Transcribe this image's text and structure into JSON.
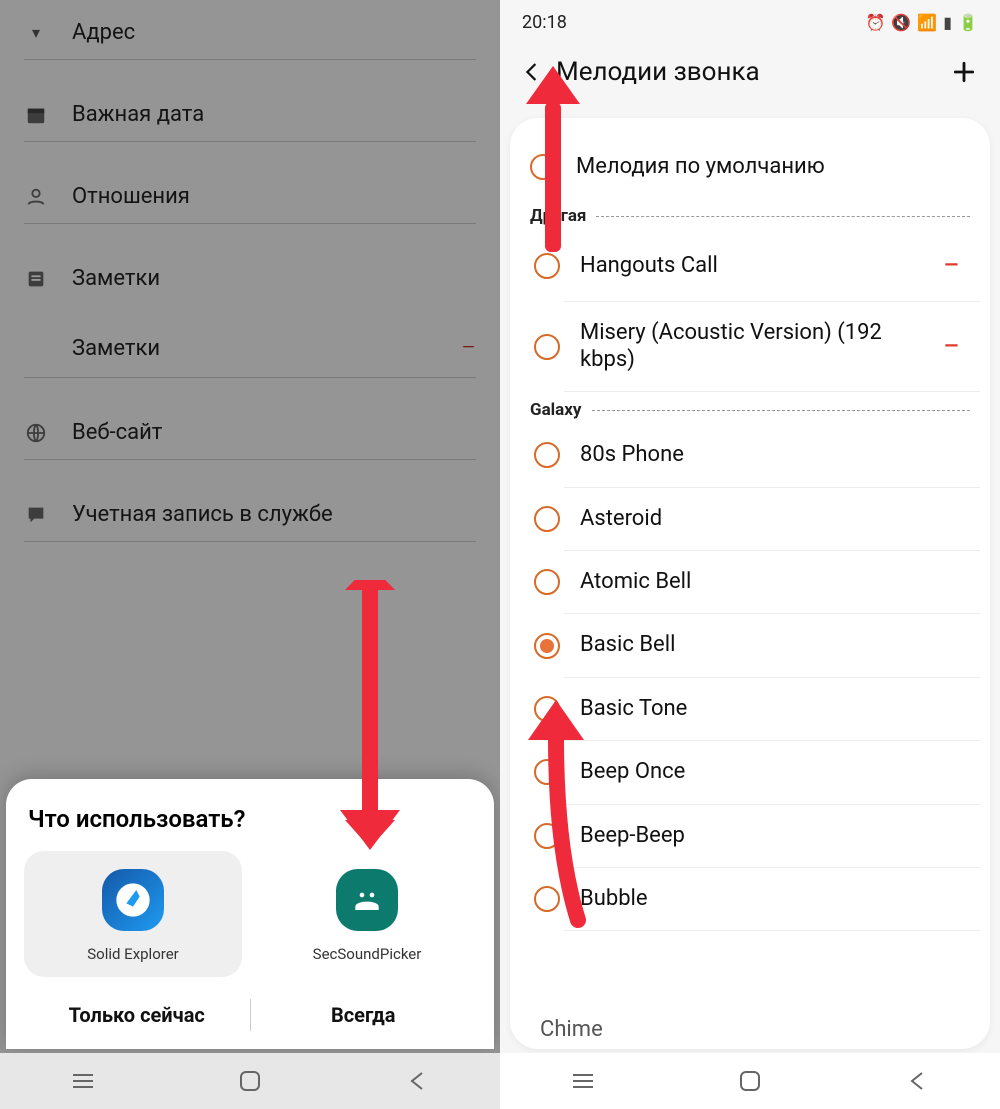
{
  "left": {
    "form": {
      "address": "Адрес",
      "date": "Важная дата",
      "relations": "Отношения",
      "notes_header": "Заметки",
      "notes_item": "Заметки",
      "website": "Веб-сайт",
      "account": "Учетная запись в службе"
    },
    "chooser": {
      "title": "Что использовать?",
      "app1": "Solid Explorer",
      "app2": "SecSoundPicker",
      "once": "Только сейчас",
      "always": "Всегда"
    }
  },
  "right": {
    "status": {
      "time": "20:18"
    },
    "appbar": {
      "title": "Мелодии звонка"
    },
    "default_tone": "Мелодия по умолчанию",
    "section_other": "Другая",
    "section_galaxy": "Galaxy",
    "other": [
      {
        "label": "Hangouts Call",
        "deletable": true
      },
      {
        "label": "Misery (Acoustic Version) (192  kbps)",
        "deletable": true
      }
    ],
    "galaxy": [
      {
        "label": "80s Phone",
        "checked": false
      },
      {
        "label": "Asteroid",
        "checked": false
      },
      {
        "label": "Atomic Bell",
        "checked": false
      },
      {
        "label": "Basic Bell",
        "checked": true
      },
      {
        "label": "Basic Tone",
        "checked": false
      },
      {
        "label": "Beep Once",
        "checked": false
      },
      {
        "label": "Beep-Beep",
        "checked": false
      },
      {
        "label": "Bubble",
        "checked": false
      }
    ],
    "cutoff": "Chime"
  }
}
